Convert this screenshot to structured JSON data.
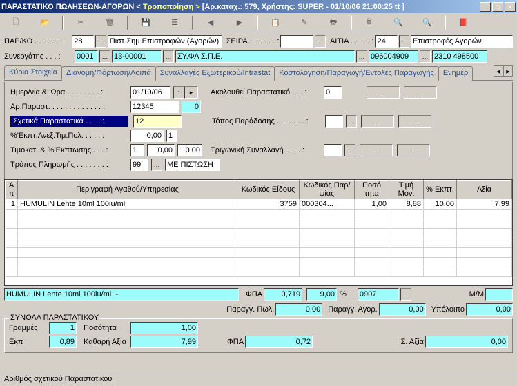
{
  "window": {
    "title_plain": "ΠΑΡΑΣΤΑΤΙΚΟ ΠΩΛΗΣΕΩΝ-ΑΓΟΡΩΝ <",
    "title_em": " Τροποποίηση > ",
    "title_after": "[Αρ.καταχ.: 579, Χρήστης: SUPER - 01/10/06 21:00:25 tt ]"
  },
  "header": {
    "parko_label": "ΠΑΡ/ΚΟ . . . . . . :",
    "parko": "28",
    "parko_desc": "Πιστ.Σημ.Επιστροφών (Αγορών)",
    "seira_label": "ΣΕΙΡΑ. . . . . . . :",
    "seira": "",
    "aitia_label": "ΑΙΤΙΑ . . . . . :",
    "aitia": "24",
    "aitia_desc": "Επιστροφές Αγορών",
    "syn_label": "Συνεργάτης . . . :",
    "syn1": "0001",
    "syn2": "13-00001",
    "syn_name": "ΣΥ.ΦΑ Σ.Π.Ε.",
    "afm": "096004909",
    "phone": "2310 498500"
  },
  "tabs": {
    "t0": "Κύρια Στοιχεία",
    "t1": "Διανομή/Φόρτωση/Λοιπά",
    "t2": "Συναλλαγές Εξωτερικού/Intrastat",
    "t3": "Κοστολόγηση/Παραγωγή/Εντολές Παραγωγής",
    "t4": "Ενημέρ"
  },
  "main": {
    "date_label": "Ημερ/νία & 'Ωρα . . . . . . . . :",
    "date": "01/10/06",
    "follow_label": "Ακολουθεί Παραστατικό . . . :",
    "follow": "0",
    "arparast_label": "Αρ.Παραστ. . . . . . . . . . . . . :",
    "arparast": "12345",
    "arparast2": "0",
    "related_label": "Σχετικά Παραστατικά . . . . :",
    "related": "12",
    "topos_label": "Τόπος Παράδοσης . . . . . . . :",
    "ekpt_label": "%'Εκπτ.Ανεξ.Τιμ.Πολ. . . . . :",
    "ekpt1": "0,00",
    "ekpt2": "1",
    "timokat_label": "Τιμοκατ. & %'Εκπτωσης . . . :",
    "timokat1": "1",
    "timokat2": "0,00",
    "timokat3": "0,00",
    "trig_label": "Τριγωνική Συναλλαγή . . . . :",
    "tropos_label": "Τρόπος Πληρωμής . . . . . . . :",
    "tropos": "99",
    "tropos_desc": "ΜΕ ΠΙΣΤΩΣΗ"
  },
  "grid": {
    "h_aa": "A\nπ",
    "h_desc": "Περιγραφή\nΑγαθού/Υπηρεσίας",
    "h_code": "Κωδικός\nΕίδους",
    "h_pcode": "Κωδικός\nΠαρ/ψίας",
    "h_qty": "Ποσό\nτητα",
    "h_price": "Τιμή\nΜον.",
    "h_pct": "%\nΕκπτ.",
    "h_val": "Αξία",
    "rows": [
      {
        "aa": "1",
        "desc": "HUMULIN Lente 10ml 100iu/ml",
        "code": "3759",
        "pcode": "000304...",
        "qty": "1,00",
        "price": "8,88",
        "pct": "10,00",
        "val": "7,99"
      }
    ]
  },
  "footer": {
    "item_desc": "HUMULIN Lente 10ml 100iu/ml  -",
    "fpa_label": "ΦΠΑ",
    "fpa_val": "0,719",
    "fpa_pct": "9,00",
    "pct_sym": "%",
    "code2": "0907",
    "mm_label": "Μ/Μ",
    "parpol_label": "Παραγγ. Πωλ.",
    "parpol": "0,00",
    "paragor_label": "Παραγγ. Αγορ.",
    "paragor": "0,00",
    "ypol_label": "Υπόλοιπο",
    "ypol": "0,00"
  },
  "totals": {
    "legend": "ΣΥΝΟΛΑ ΠΑΡΑΣΤΑΤΙΚΟΥ",
    "lines_label": "Γραμμές",
    "lines": "1",
    "qty_label": "Ποσότητα",
    "qty": "1,00",
    "ekp_label": "Εκπ",
    "ekp": "0,89",
    "net_label": "Καθαρή Αξία",
    "net": "7,99",
    "fpa_label": "ΦΠΑ",
    "fpa": "0,72",
    "total_label": "Σ. Αξία",
    "total": "0,00"
  },
  "status": "Αριθμός σχετικού Παραστατικού"
}
